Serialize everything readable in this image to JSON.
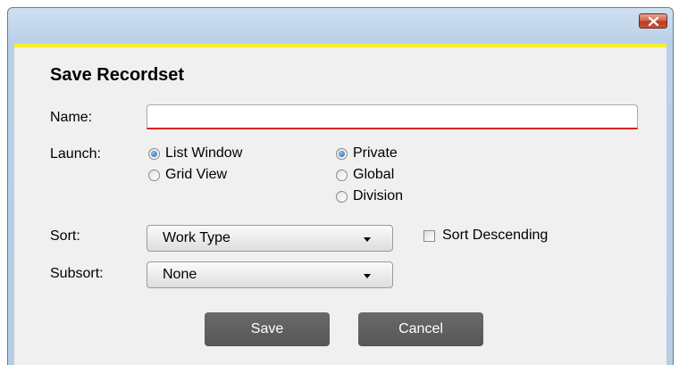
{
  "dialog": {
    "title": "Save Recordset"
  },
  "name": {
    "label": "Name:",
    "value": ""
  },
  "launch": {
    "label": "Launch:",
    "mode_options": [
      {
        "label": "List Window",
        "checked": true
      },
      {
        "label": "Grid View",
        "checked": false
      }
    ],
    "scope_options": [
      {
        "label": "Private",
        "checked": true
      },
      {
        "label": "Global",
        "checked": false
      },
      {
        "label": "Division",
        "checked": false
      }
    ]
  },
  "sort": {
    "label": "Sort:",
    "value": "Work Type",
    "descending_label": "Sort Descending",
    "descending_checked": false
  },
  "subsort": {
    "label": "Subsort:",
    "value": "None"
  },
  "buttons": {
    "save": "Save",
    "cancel": "Cancel"
  },
  "colors": {
    "accent_line": "#f6ee33",
    "name_underline": "#e02020",
    "button_bg": "#5e5e5e",
    "close_button": "#c9543a"
  },
  "icons": {
    "close": "close-icon",
    "dropdown": "chevron-down-icon"
  }
}
